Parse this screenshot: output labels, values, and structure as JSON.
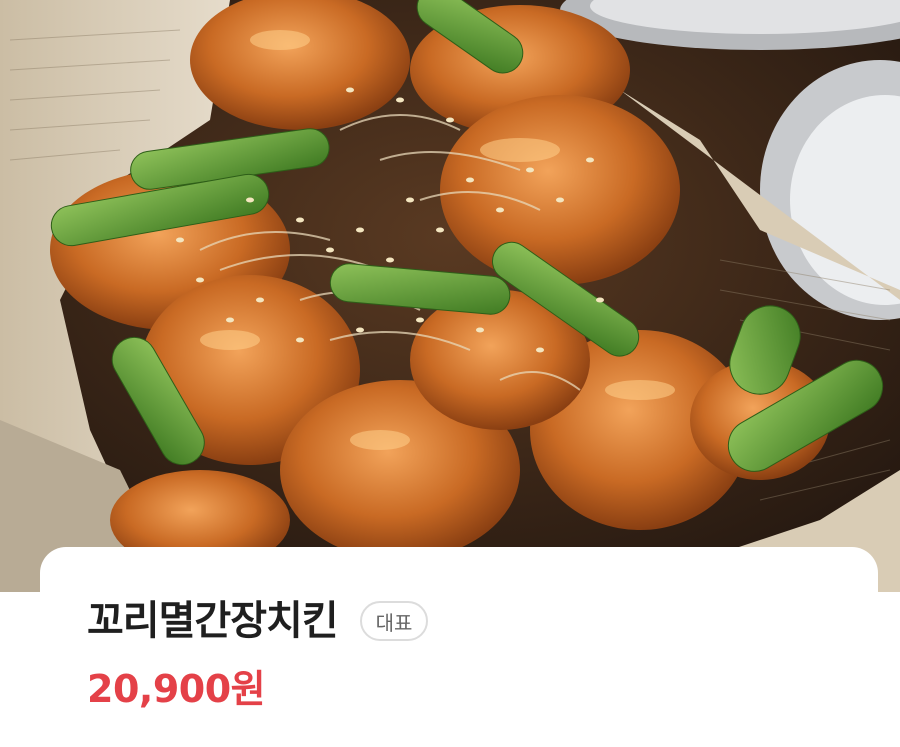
{
  "menu_item": {
    "name": "꼬리멸간장치킨",
    "badge": "대표",
    "price": "20,900원"
  },
  "colors": {
    "price": "#e44148",
    "title": "#1f1f1f",
    "badge_border": "#dcdcdc",
    "badge_text": "#666666"
  }
}
